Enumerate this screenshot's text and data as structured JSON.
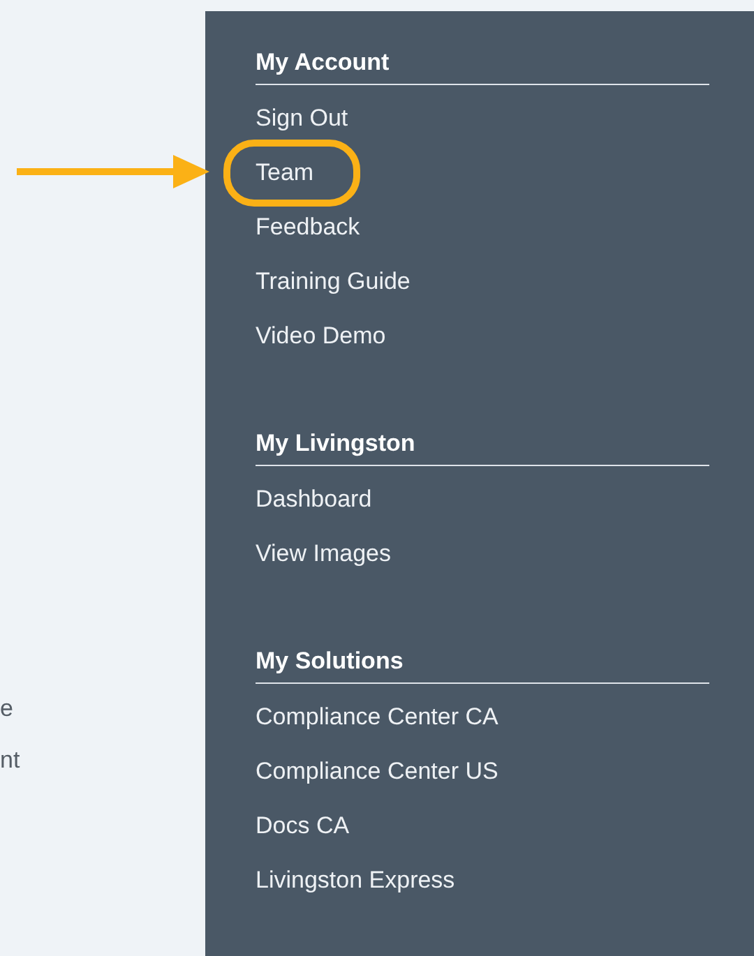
{
  "background_text": [
    "e",
    "nt"
  ],
  "sections": [
    {
      "heading": "My Account",
      "items": [
        {
          "label": "Sign Out",
          "highlighted": false
        },
        {
          "label": "Team",
          "highlighted": true
        },
        {
          "label": "Feedback",
          "highlighted": false
        },
        {
          "label": "Training Guide",
          "highlighted": false
        },
        {
          "label": "Video Demo",
          "highlighted": false
        }
      ]
    },
    {
      "heading": "My Livingston",
      "items": [
        {
          "label": "Dashboard",
          "highlighted": false
        },
        {
          "label": "View Images",
          "highlighted": false
        }
      ]
    },
    {
      "heading": "My Solutions",
      "items": [
        {
          "label": "Compliance Center CA",
          "highlighted": false
        },
        {
          "label": "Compliance Center US",
          "highlighted": false
        },
        {
          "label": "Docs CA",
          "highlighted": false
        },
        {
          "label": "Livingston Express",
          "highlighted": false
        }
      ]
    }
  ]
}
